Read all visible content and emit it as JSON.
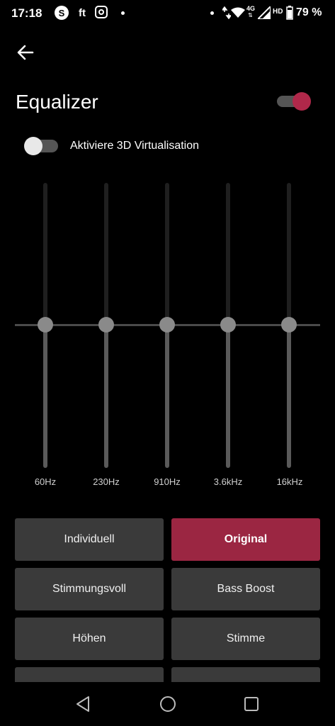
{
  "status_bar": {
    "time": "17:18",
    "apps": {
      "skype": "S",
      "ft": "ft"
    },
    "network": "4G",
    "hd": "HD",
    "battery": "79 %"
  },
  "header": {
    "title": "Equalizer",
    "equalizer_enabled": true
  },
  "virtualisation": {
    "label": "Aktiviere 3D Virtualisation",
    "enabled": false
  },
  "equalizer": {
    "bands": [
      {
        "label": "60Hz"
      },
      {
        "label": "230Hz"
      },
      {
        "label": "910Hz"
      },
      {
        "label": "3.6kHz"
      },
      {
        "label": "16kHz"
      }
    ]
  },
  "presets": [
    {
      "label": "Individuell",
      "active": false
    },
    {
      "label": "Original",
      "active": true
    },
    {
      "label": "Stimmungsvoll",
      "active": false
    },
    {
      "label": "Bass Boost",
      "active": false
    },
    {
      "label": "Höhen",
      "active": false
    },
    {
      "label": "Stimme",
      "active": false
    }
  ],
  "colors": {
    "accent": "#9b2642",
    "background": "#000000",
    "button": "#3a3a3a"
  }
}
